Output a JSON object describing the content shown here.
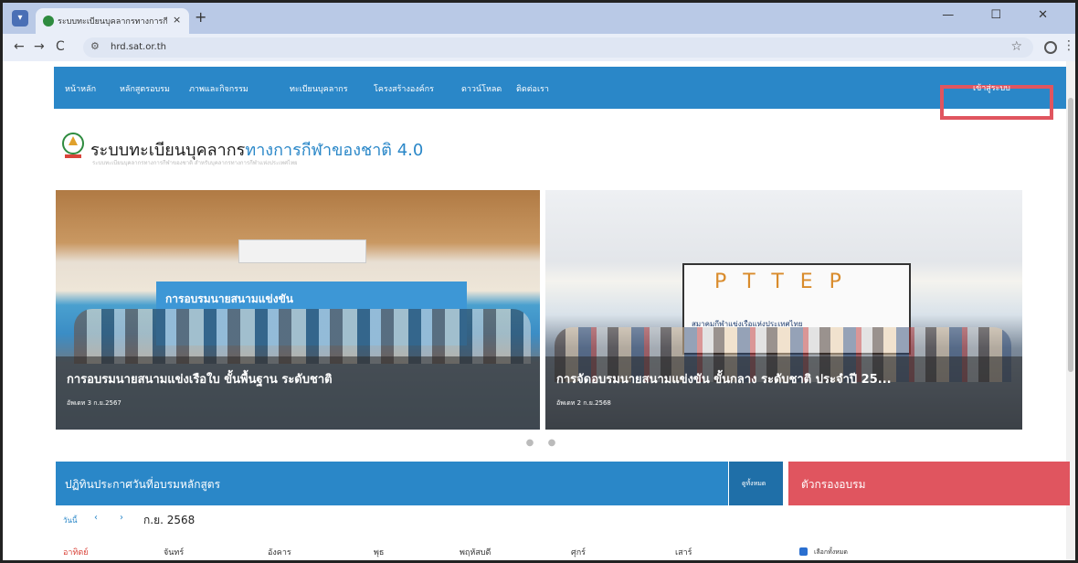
{
  "browser": {
    "tab_title": "ระบบทะเบียนบุคลากรทางการกีฬาของชาติ",
    "tab_close": "×",
    "new_tab": "+",
    "url": "hrd.sat.or.th",
    "window_controls": "— ☐ ✕"
  },
  "nav": {
    "items": [
      "หน้าหลัก",
      "หลักสูตรอบรม",
      "ภาพและกิจกรรม",
      "ทะเบียนบุคลากร",
      "โครงสร้างองค์กร",
      "ดาวน์โหลด",
      "ติดต่อเรา"
    ],
    "login": "เข้าสู่ระบบ"
  },
  "header": {
    "title_prefix": "ระบบทะเบียนบุคลากร",
    "title_highlight": "ทางการกีฬาของชาติ 4.0",
    "subtitle": "ระบบทะเบียนบุคลากรทางการกีฬาของชาติ สำหรับบุคลากรทางการกีฬาแห่งประเทศไทย"
  },
  "slides": [
    {
      "title": "การอบรมนายสนามแข่งเรือใบ ขั้นพื้นฐาน ระดับชาติ",
      "date": "อัพเดท 3 ก.ย.2567",
      "banner": "การอบรมนายสนามแข่งขัน"
    },
    {
      "title": "การจัดอบรมนายสนามแข่งขัน ขั้นกลาง ระดับชาติ ประจำปี 25...",
      "date": "อัพเดท 2 ก.ย.2568",
      "banner": "สมาคมกีฬาแข่งเรือแห่งประเทศไทย",
      "logos": "PTTEP"
    }
  ],
  "carousel": {
    "dots": "● ●"
  },
  "announcements": {
    "title": "ปฏิทินประกาศวันที่อบรมหลักสูตร",
    "view_all": "ดูทั้งหมด",
    "today": "วันนี้",
    "prev": "‹",
    "next": "›",
    "month": "ก.ย. 2568",
    "weekdays": [
      "อาทิตย์",
      "จันทร์",
      "อังคาร",
      "พุธ",
      "พฤหัสบดี",
      "ศุกร์",
      "เสาร์"
    ]
  },
  "filter": {
    "title": "ตัวกรองอบรม",
    "select_all": "เลือกทั้งหมด"
  },
  "colors": {
    "nav_blue": "#2a87c8",
    "filter_red": "#e0555f",
    "highlight_box": "#e0555f"
  }
}
